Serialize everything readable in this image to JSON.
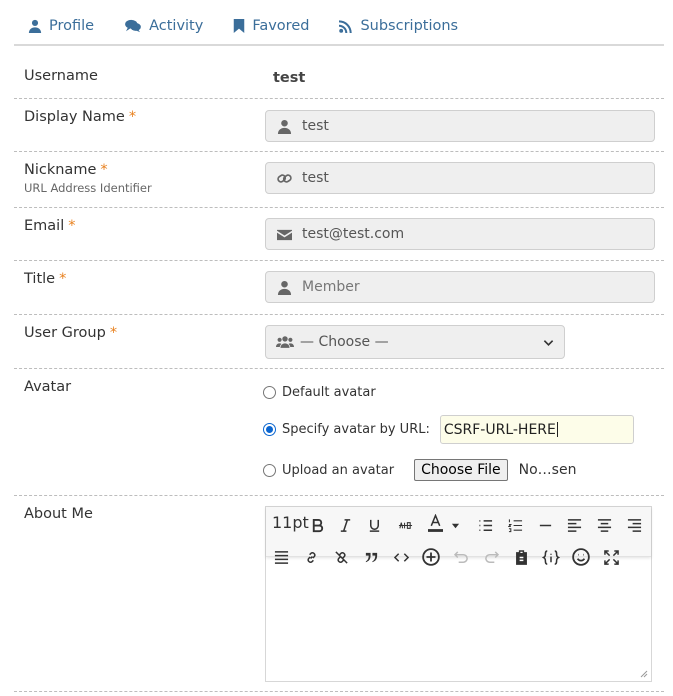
{
  "tabs": [
    {
      "label": "Profile",
      "icon": "user-icon"
    },
    {
      "label": "Activity",
      "icon": "comments-icon"
    },
    {
      "label": "Favored",
      "icon": "bookmark-icon"
    },
    {
      "label": "Subscriptions",
      "icon": "rss-icon"
    }
  ],
  "colors": {
    "link": "#3b6e9a",
    "required": "#e8811f",
    "radio_checked": "#0b66d0"
  },
  "form": {
    "username": {
      "label": "Username",
      "value": "test"
    },
    "display_name": {
      "label": "Display Name",
      "required": "*",
      "value": "test"
    },
    "nickname": {
      "label": "Nickname",
      "required": "*",
      "sublabel": "URL Address Identifier",
      "value": "test"
    },
    "email": {
      "label": "Email",
      "required": "*",
      "value": "test@test.com"
    },
    "title": {
      "label": "Title",
      "required": "*",
      "placeholder": "Member"
    },
    "user_group": {
      "label": "User Group",
      "required": "*",
      "selected": "— Choose —"
    },
    "avatar": {
      "label": "Avatar",
      "option_default": "Default avatar",
      "option_url": "Specify avatar by URL:",
      "url_value": "CSRF-URL-HERE",
      "option_upload": "Upload an avatar",
      "file_button": "Choose File",
      "file_status": "No…sen",
      "selected": "url"
    },
    "about": {
      "label": "About Me",
      "font_size": "11pt"
    }
  }
}
